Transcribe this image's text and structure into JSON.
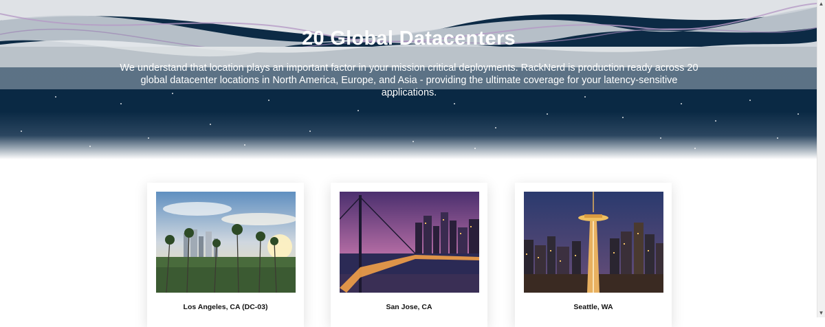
{
  "hero": {
    "title": "20 Global Datacenters",
    "subtitle": "We understand that location plays an important factor in your mission critical deployments. RackNerd is production ready across 20 global datacenter locations in North America, Europe, and Asia - providing the ultimate coverage for your latency-sensitive applications."
  },
  "locations": [
    {
      "name": "Los Angeles, CA (DC-03)",
      "image": "los-angeles-skyline-photo"
    },
    {
      "name": "San Jose, CA",
      "image": "bay-bridge-night-photo"
    },
    {
      "name": "Seattle, WA",
      "image": "seattle-space-needle-photo"
    }
  ],
  "colors": {
    "hero_navy": "#0a2944",
    "band_light": "#e1e4e7",
    "card_bg": "#ffffff",
    "text_dark": "#111111"
  }
}
